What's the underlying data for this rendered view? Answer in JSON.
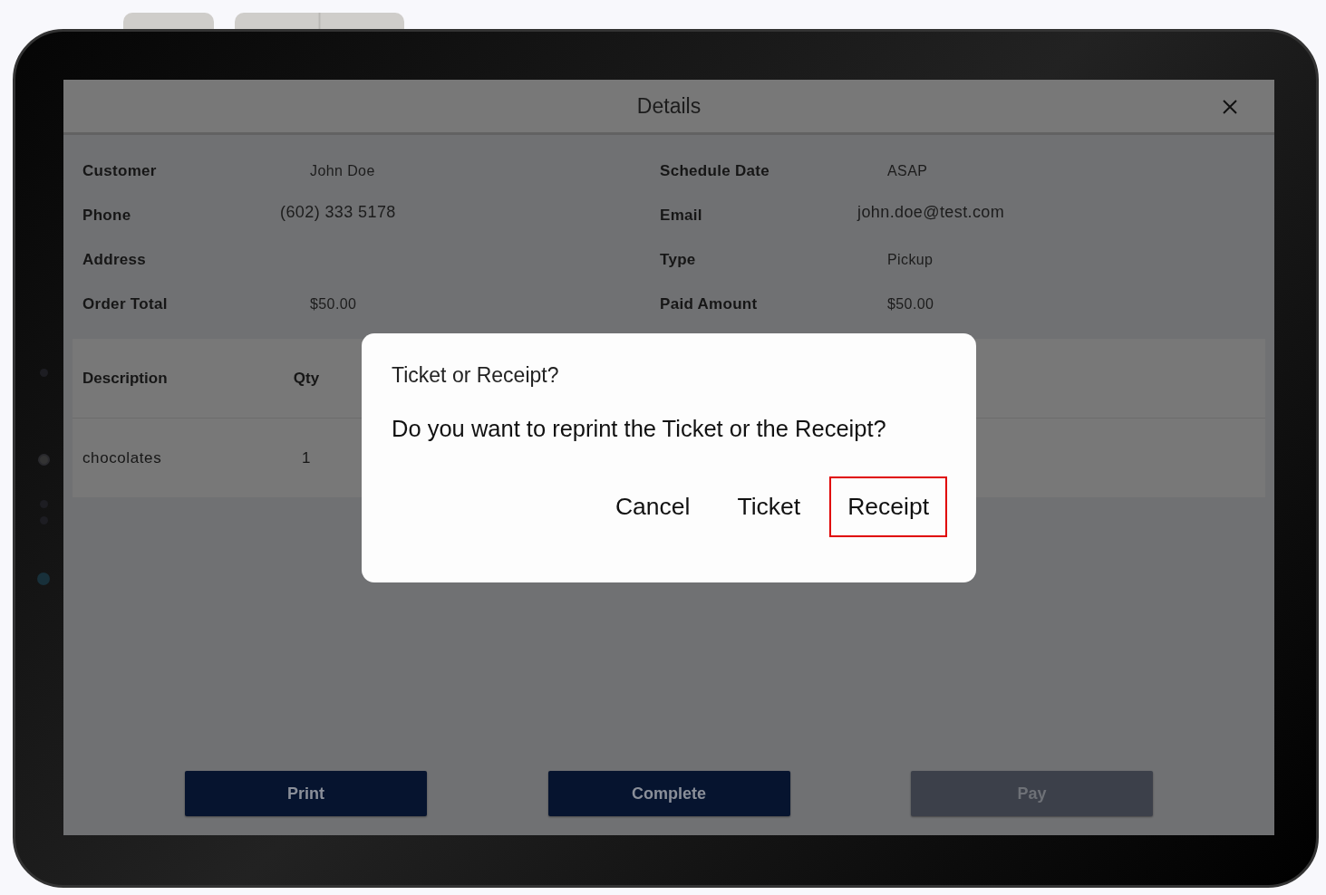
{
  "window": {
    "title": "Details"
  },
  "details": [
    {
      "label": "Customer",
      "value": "John Doe",
      "kind": "plain"
    },
    {
      "label": "Schedule Date",
      "value": "ASAP",
      "kind": "plain"
    },
    {
      "label": "Phone",
      "value": "(602) 333 5178",
      "kind": "large"
    },
    {
      "label": "Email",
      "value": "john.doe@test.com",
      "kind": "large"
    },
    {
      "label": "Address",
      "kind": "plain"
    },
    {
      "label": "Type",
      "value": "Pickup",
      "kind": "plain"
    },
    {
      "label": "Order Total",
      "value": "$50.00",
      "kind": "plain"
    },
    {
      "label": "Paid Amount",
      "value": "$50.00",
      "kind": "plain"
    }
  ],
  "table": {
    "columns": [
      "Description",
      "Qty"
    ],
    "rows": [
      [
        "chocolates",
        "1"
      ]
    ]
  },
  "dialog": {
    "title": "Ticket or Receipt?",
    "message": "Do you want to reprint the Ticket or the Receipt?",
    "buttons": [
      {
        "label": "Cancel",
        "focused": false
      },
      {
        "label": "Ticket",
        "focused": false
      },
      {
        "label": "Receipt",
        "focused": true
      }
    ]
  },
  "actions": [
    {
      "label": "Print",
      "disabled": false
    },
    {
      "label": "Complete",
      "disabled": false
    },
    {
      "label": "Pay",
      "disabled": true
    }
  ]
}
